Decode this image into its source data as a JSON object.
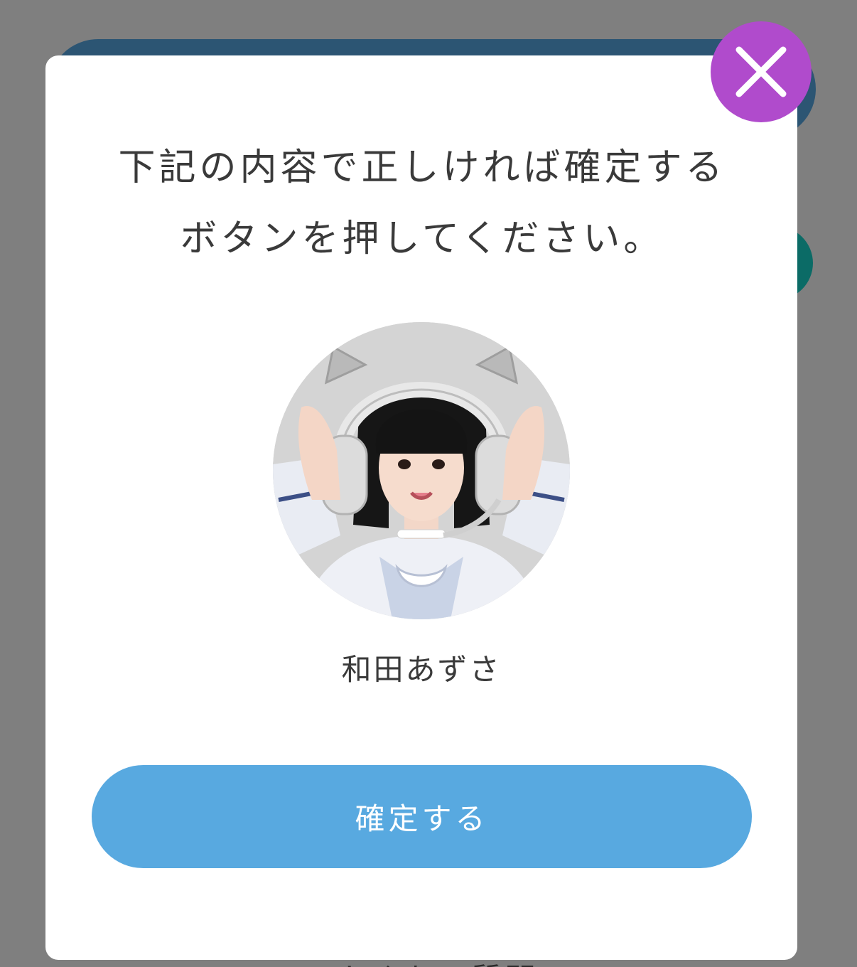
{
  "background_page": {
    "peek_text": "よくある質問"
  },
  "modal": {
    "message_lines": [
      "下記の内容で正しければ確定する",
      "ボタンを押してください。"
    ],
    "member": {
      "name": "和田あずさ",
      "photo_description": "profile photo of member wearing cat-ear headphones"
    },
    "confirm_button_label": "確定する",
    "close_button_icon": "close-icon"
  },
  "colors": {
    "overlay": "#7f7f7f",
    "modal_background": "#ffffff",
    "close_button": "#b04bcc",
    "confirm_button": "#58a9e0",
    "text": "#3a3a3a",
    "background_header": "#2c5573",
    "background_accent": "#0b6b66"
  }
}
